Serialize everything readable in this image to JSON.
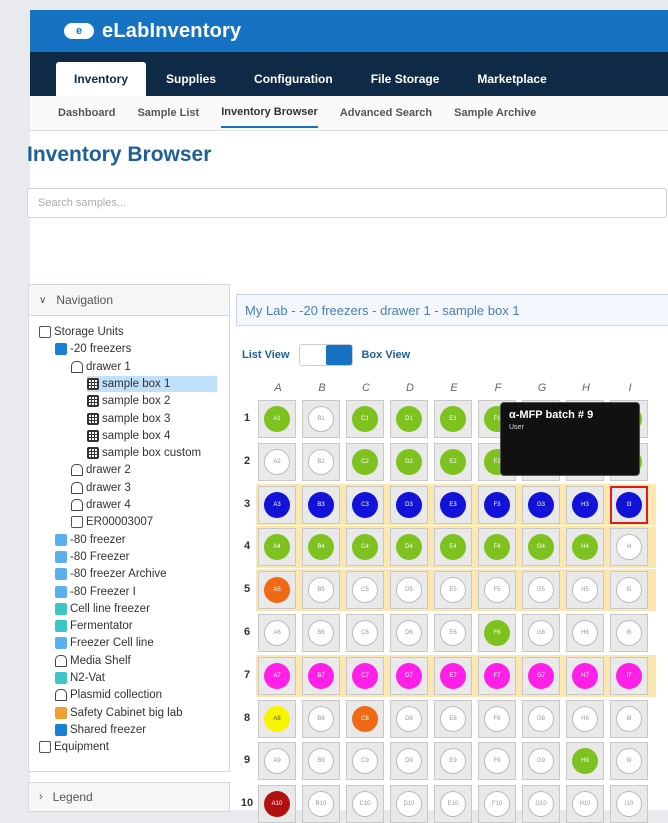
{
  "app": {
    "logo_text": "e",
    "brand": "eLabInventory"
  },
  "main_nav": [
    "Inventory",
    "Supplies",
    "Configuration",
    "File Storage",
    "Marketplace"
  ],
  "sub_nav": [
    "Dashboard",
    "Sample List",
    "Inventory Browser",
    "Advanced Search",
    "Sample Archive"
  ],
  "page_title": "Inventory Browser",
  "search": {
    "placeholder": "Search samples..."
  },
  "navigation": {
    "title": "Navigation"
  },
  "legend": {
    "title": "Legend"
  },
  "tree": [
    {
      "label": "Storage Units",
      "icon": "plain",
      "indent": 0
    },
    {
      "label": "-20 freezers",
      "icon": "freezer-dark",
      "indent": 1
    },
    {
      "label": "drawer 1",
      "icon": "drawer",
      "indent": 2
    },
    {
      "label": "sample box 1",
      "icon": "box",
      "indent": 3,
      "selected": true
    },
    {
      "label": "sample box 2",
      "icon": "box",
      "indent": 3
    },
    {
      "label": "sample box 3",
      "icon": "box",
      "indent": 3
    },
    {
      "label": "sample box 4",
      "icon": "box",
      "indent": 3
    },
    {
      "label": "sample box custom",
      "icon": "box",
      "indent": 3
    },
    {
      "label": "drawer 2",
      "icon": "drawer",
      "indent": 2
    },
    {
      "label": "drawer 3",
      "icon": "drawer",
      "indent": 2
    },
    {
      "label": "drawer 4",
      "icon": "drawer",
      "indent": 2
    },
    {
      "label": "ER00003007",
      "icon": "plain",
      "indent": 2
    },
    {
      "label": "-80 freezer",
      "icon": "freezer",
      "indent": 1
    },
    {
      "label": "-80 Freezer",
      "icon": "freezer",
      "indent": 1
    },
    {
      "label": "-80 freezer Archive",
      "icon": "freezer",
      "indent": 1
    },
    {
      "label": "-80 Freezer I",
      "icon": "freezer",
      "indent": 1
    },
    {
      "label": "Cell line freezer",
      "icon": "teal",
      "indent": 1
    },
    {
      "label": "Fermentator",
      "icon": "teal",
      "indent": 1
    },
    {
      "label": "Freezer Cell line",
      "icon": "freezer",
      "indent": 1
    },
    {
      "label": "Media Shelf",
      "icon": "drawer",
      "indent": 1
    },
    {
      "label": "N2-Vat",
      "icon": "teal",
      "indent": 1
    },
    {
      "label": "Plasmid collection",
      "icon": "drawer",
      "indent": 1
    },
    {
      "label": "Safety Cabinet big lab",
      "icon": "orange",
      "indent": 1
    },
    {
      "label": "Shared freezer",
      "icon": "freezer-dark",
      "indent": 1
    },
    {
      "label": "Equipment",
      "icon": "plain",
      "indent": 0
    }
  ],
  "breadcrumb": "My Lab - -20 freezers - drawer 1 - sample box 1",
  "view": {
    "list": "List View",
    "box": "Box View",
    "active": "box"
  },
  "columns": [
    "A",
    "B",
    "C",
    "D",
    "E",
    "F",
    "G",
    "H",
    "I"
  ],
  "rows": [
    "1",
    "2",
    "3",
    "4",
    "5",
    "6",
    "7",
    "8",
    "9",
    "10"
  ],
  "row_highlight": {
    "3": "#fde7b0",
    "4": "#fde7b0",
    "5": "#fde7b0",
    "7": "#fde7b0"
  },
  "colors": {
    "green": "#7ec21f",
    "blue": "#1212d8",
    "magenta": "#ff1fe6",
    "orange": "#f06a16",
    "yellow": "#f8f500",
    "darkred": "#b01010",
    "empty": "#ffffff",
    "accent": "#1673c4"
  },
  "cells": [
    [
      "green",
      "empty",
      "green",
      "green",
      "green",
      "green",
      "green",
      "green",
      "green"
    ],
    [
      "empty",
      "empty",
      "green",
      "green",
      "green",
      "green",
      "green",
      "green",
      "green"
    ],
    [
      "blue",
      "blue",
      "blue",
      "blue",
      "blue",
      "blue",
      "blue",
      "blue",
      "blue"
    ],
    [
      "green",
      "green",
      "green",
      "green",
      "green",
      "green",
      "green",
      "green",
      "empty"
    ],
    [
      "orange",
      "empty",
      "empty",
      "empty",
      "empty",
      "empty",
      "empty",
      "empty",
      "empty"
    ],
    [
      "empty",
      "empty",
      "empty",
      "empty",
      "empty",
      "green",
      "empty",
      "empty",
      "empty"
    ],
    [
      "magenta",
      "magenta",
      "magenta",
      "magenta",
      "magenta",
      "magenta",
      "magenta",
      "magenta",
      "magenta"
    ],
    [
      "yellow",
      "empty",
      "orange",
      "empty",
      "empty",
      "empty",
      "empty",
      "empty",
      "empty"
    ],
    [
      "empty",
      "empty",
      "empty",
      "empty",
      "empty",
      "empty",
      "empty",
      "green",
      "empty"
    ],
    [
      "darkred",
      "empty",
      "empty",
      "empty",
      "empty",
      "empty",
      "empty",
      "empty",
      "empty"
    ]
  ],
  "tooltip": {
    "title": "α-MFP batch # 9",
    "subtitle": "User"
  }
}
